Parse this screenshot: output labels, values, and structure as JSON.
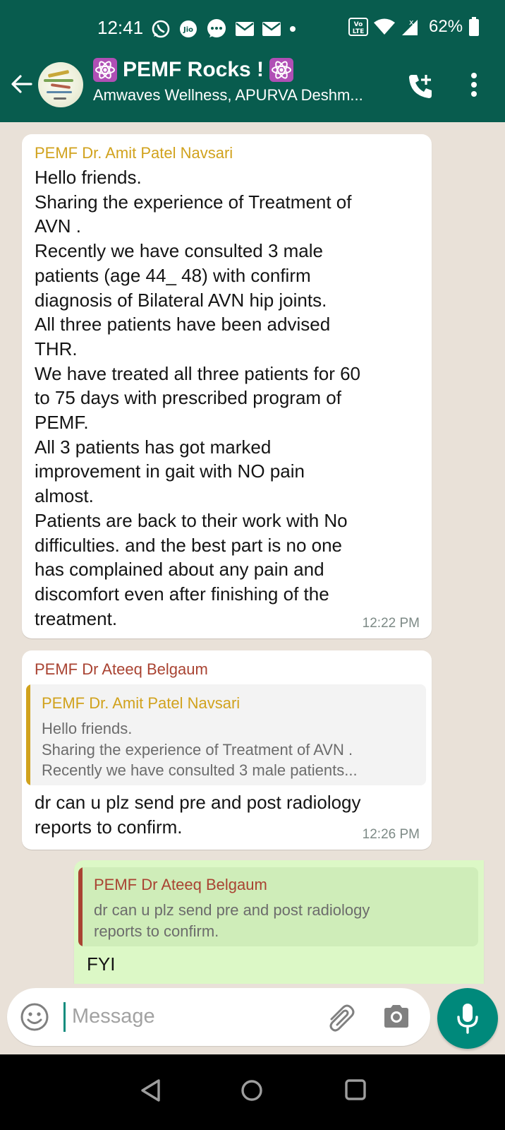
{
  "status_bar": {
    "time": "12:41",
    "battery": "62%",
    "icons": [
      "whatsapp-icon",
      "jio-icon",
      "chat-icon",
      "mail-icon",
      "mail-icon",
      "dot-icon",
      "volte-icon",
      "wifi-icon",
      "signal-icon",
      "battery-icon"
    ]
  },
  "header": {
    "group_name": "PEMF Rocks !",
    "members": "Amwaves Wellness, APURVA Deshm...",
    "icons": [
      "back-arrow-icon",
      "atom-emoji-icon",
      "add-call-icon",
      "more-vert-icon"
    ]
  },
  "messages": [
    {
      "sender": "PEMF Dr. Amit Patel Navsari",
      "sender_color": "#d1a21d",
      "text": "Hello friends.\nSharing the experience of Treatment of\nAVN .\nRecently we have consulted 3  male\npatients  (age 44_ 48) with confirm\ndiagnosis of Bilateral AVN hip joints.\nAll three patients have been advised\nTHR.\nWe have treated all three patients for 60\nto 75 days with prescribed program of\nPEMF.\nAll 3 patients has got marked\nimprovement in gait with NO pain\nalmost.\nPatients are back to their work with No\ndifficulties. and the best part is no one\nhas complained about any pain and\ndiscomfort even after finishing of the\ntreatment.",
      "time": "12:22 PM"
    },
    {
      "sender": "PEMF Dr Ateeq Belgaum",
      "sender_color": "#a94332",
      "quote": {
        "sender": "PEMF Dr. Amit Patel Navsari",
        "sender_color": "#d1a21d",
        "text": "Hello friends.\nSharing the experience of Treatment of AVN .\nRecently we have consulted 3  male patients..."
      },
      "text": "dr can u plz send pre and post radiology\nreports to confirm.",
      "time": "12:26 PM"
    },
    {
      "outgoing": true,
      "quote": {
        "sender": "PEMF Dr Ateeq Belgaum",
        "sender_color": "#a94332",
        "text": "dr can u plz send pre and post radiology\nreports to confirm."
      },
      "text": "FYI"
    }
  ],
  "composer": {
    "placeholder": "Message",
    "icons": [
      "emoji-icon",
      "attach-icon",
      "camera-icon",
      "mic-icon"
    ]
  },
  "nav_bar": {
    "icons": [
      "nav-back-icon",
      "nav-home-icon",
      "nav-recents-icon"
    ]
  }
}
